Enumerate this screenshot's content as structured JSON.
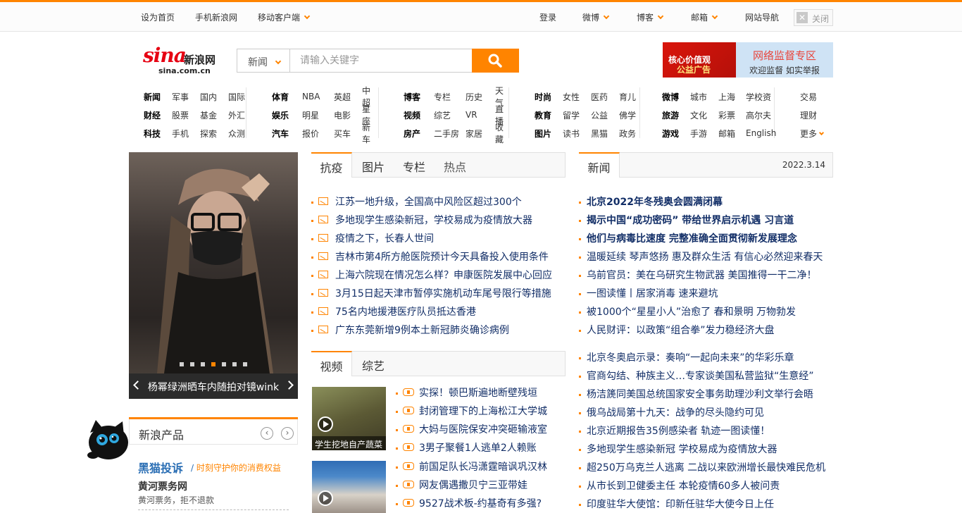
{
  "topbar": {
    "set_home": "设为首页",
    "mobile_sina": "手机新浪网",
    "mobile_client": "移动客户端",
    "login": "登录",
    "weibo": "微博",
    "blog": "博客",
    "mail": "邮箱",
    "site_nav": "网站导航",
    "close": "关闭"
  },
  "logo": {
    "brand": "sina",
    "cn": "新浪网",
    "domain": "sina.com.cn"
  },
  "search": {
    "category": "新闻",
    "placeholder": "请输入关键字"
  },
  "ads": {
    "ad1_line1": "核心价值观",
    "ad1_line2": "公益广告",
    "ad2_title": "网络监督专区",
    "ad2_sub": "欢迎监督 如实举报"
  },
  "nav": [
    {
      "rows": [
        [
          "新闻",
          "军事",
          "国内",
          "国际"
        ],
        [
          "财经",
          "股票",
          "基金",
          "外汇"
        ],
        [
          "科技",
          "手机",
          "探索",
          "众测"
        ]
      ]
    },
    {
      "rows": [
        [
          "体育",
          "NBA",
          "英超",
          "中超"
        ],
        [
          "娱乐",
          "明星",
          "电影",
          "星座"
        ],
        [
          "汽车",
          "报价",
          "买车",
          "新车"
        ]
      ]
    },
    {
      "rows": [
        [
          "博客",
          "专栏",
          "历史",
          "天气"
        ],
        [
          "视频",
          "综艺",
          "VR",
          "直播"
        ],
        [
          "房产",
          "二手房",
          "家居",
          "收藏"
        ]
      ]
    },
    {
      "rows": [
        [
          "时尚",
          "女性",
          "医药",
          "育儿"
        ],
        [
          "教育",
          "留学",
          "公益",
          "佛学"
        ],
        [
          "图片",
          "读书",
          "黑猫",
          "政务"
        ]
      ]
    },
    {
      "rows": [
        [
          "微博",
          "城市",
          "上海",
          "学校资"
        ],
        [
          "旅游",
          "文化",
          "彩票",
          "高尔夫"
        ],
        [
          "游戏",
          "手游",
          "邮箱",
          "English"
        ]
      ]
    },
    {
      "rows": [
        [
          "交易"
        ],
        [
          "理财"
        ],
        [
          "更多"
        ]
      ]
    }
  ],
  "slideshow": {
    "caption": "杨幂绿洲晒车内随拍对镜wink",
    "active_dot": 3,
    "dot_count": 7
  },
  "products": {
    "title": "新浪产品",
    "tousu": "黑猫投诉",
    "slash": "/",
    "slogan": "时刻守护你的消费权益",
    "huanghe": "黄河票务网",
    "huanghe_desc": "黄河票务，拒不退款"
  },
  "epidemic": {
    "tabs": [
      "抗疫",
      "图片",
      "专栏",
      "热点"
    ],
    "items": [
      "江苏一地升级，全国高中风险区超过300个",
      "多地现学生感染新冠，学校易成为疫情放大器",
      "疫情之下，长春人世间",
      "吉林市第4所方舱医院预计今天具备投入使用条件",
      "上海六院现在情况怎么样？申康医院发展中心回应",
      "3月15日起天津市暂停实施机动车尾号限行等措施",
      "75名内地援港医疗队员抵达香港",
      "广东东莞新增9例本土新冠肺炎确诊病例"
    ]
  },
  "video": {
    "tabs": [
      "视频",
      "综艺"
    ],
    "thumb1_caption": "学生挖地自产蔬菜",
    "items": [
      "实探！顿巴斯遍地断壁残垣",
      "封闭管理下的上海松江大学城",
      "大妈与医院保安冲突砸输液室",
      "3男子聚餐1人逃单2人赖账",
      "前国足队长冯潇霆暗讽巩汉林",
      "网友偶遇撒贝宁三亚带娃",
      "9527战术板-约基奇有多强?"
    ]
  },
  "news": {
    "tab": "新闻",
    "date": "2022.3.14",
    "headlines": [
      "北京2022年冬残奥会圆满闭幕",
      "揭示中国“成功密码” 带给世界启示机遇 习言道",
      "他们与病毒比速度 完整准确全面贯彻新发展理念"
    ],
    "items": [
      "温暖延续 琴声悠扬 惠及群众生活 有信心必然迎来春天",
      "乌前官员：美在乌研究生物武器 美国推得一干二净！",
      "一图读懂丨居家消毒 速来避坑",
      "被1000个“星星小人”治愈了 春和景明 万物勃发",
      "人民财评：以政策“组合拳”发力稳经济大盘"
    ],
    "items2": [
      "北京冬奥启示录：奏响“一起向未来”的华彩乐章",
      "官商勾结、种族主义…专家谈美国私营监狱“生意经”",
      "杨洁篪同美国总统国家安全事务助理沙利文举行会晤",
      "俄乌战局第十九天：战争的尽头隐约可见",
      "北京近期报告35例感染者 轨迹一图读懂！",
      "多地现学生感染新冠 学校易成为疫情放大器",
      "超250万乌克兰人逃离 二战以来欧洲增长最快难民危机",
      "从市长到卫健委主任 本轮疫情60多人被问责",
      "印度驻华大使馆：印新任驻华大使今日上任"
    ]
  },
  "colors": {
    "accent": "#ff8400",
    "link": "#122e67",
    "brand_red": "#e60012"
  }
}
